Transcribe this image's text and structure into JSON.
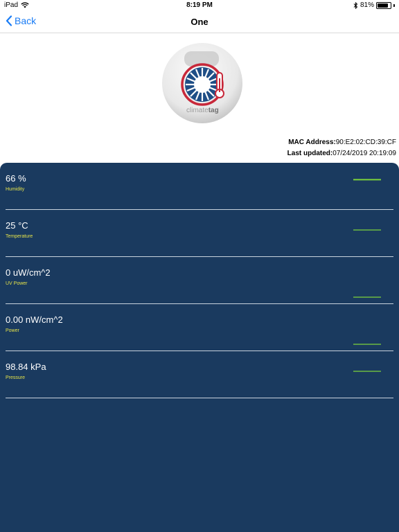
{
  "status_bar": {
    "device": "iPad",
    "time": "8:19 PM",
    "battery": "81%",
    "battery_level": 0.81
  },
  "nav": {
    "back_label": "Back",
    "title": "One"
  },
  "device": {
    "logo_text_light": "climate",
    "logo_text_bold": "tag",
    "mac_label": "MAC Address:",
    "mac_value": "90:E2:02:CD:39:CF",
    "updated_label": "Last updated:",
    "updated_value": "07/24/2019 20:19:09"
  },
  "colors": {
    "panel": "#1a3a5f",
    "label": "#e3e14a",
    "sparkline": "#7dd33a",
    "link": "#1a7cf5"
  },
  "sensors": [
    {
      "value": "66 %",
      "label": "Humidity",
      "trend_level": 0.58
    },
    {
      "value": "25 °C",
      "label": "Temperature",
      "trend_level": 0.5
    },
    {
      "value": "0 uW/cm^2",
      "label": "UV Power",
      "trend_level": 0.0
    },
    {
      "value": "0.00 nW/cm^2",
      "label": "Power",
      "trend_level": 0.0
    },
    {
      "value": "98.84 kPa",
      "label": "Pressure",
      "trend_level": 0.5
    }
  ]
}
